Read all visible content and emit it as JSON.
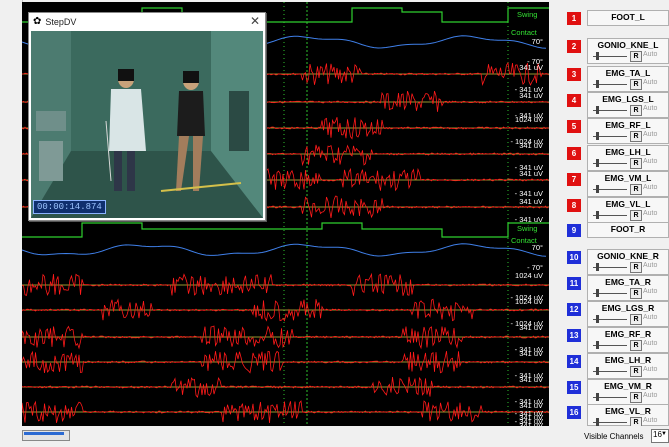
{
  "video": {
    "title": "StepDV",
    "time": "00:00:14.874"
  },
  "plot": {
    "swing_label": "Swing",
    "contact_label": "Contact",
    "labels": [
      "70°",
      "- 70°",
      "341 uV",
      "- 341 uV",
      "341 uV",
      "- 341 uV",
      "1024 uV",
      "- 1024 uV",
      "341 uV",
      "- 341 uV",
      "341 uV",
      "- 341 uV",
      "341 uV",
      "- 341 uV",
      "70°",
      "- 70°",
      "1024 uV",
      "- 1024 uV",
      "1024 uV",
      "- 1024 uV",
      "341 uV",
      "- 341 uV",
      "341 uV",
      "- 341 uV",
      "341 uV",
      "- 341 uV",
      "341 uV",
      "- 341 uV",
      "341 uV",
      "- 341 uV",
      "341 uV"
    ]
  },
  "channels": [
    {
      "num": "1",
      "name": "FOOT_L",
      "type": "foot",
      "color": "#e01010"
    },
    {
      "num": "2",
      "name": "GONIO_KNE_L",
      "type": "emg",
      "color": "#e01010"
    },
    {
      "num": "3",
      "name": "EMG_TA_L",
      "type": "emg",
      "color": "#e01010"
    },
    {
      "num": "4",
      "name": "EMG_LGS_L",
      "type": "emg",
      "color": "#e01010"
    },
    {
      "num": "5",
      "name": "EMG_RF_L",
      "type": "emg",
      "color": "#e01010"
    },
    {
      "num": "6",
      "name": "EMG_LH_L",
      "type": "emg",
      "color": "#e01010"
    },
    {
      "num": "7",
      "name": "EMG_VM_L",
      "type": "emg",
      "color": "#e01010"
    },
    {
      "num": "8",
      "name": "EMG_VL_L",
      "type": "emg",
      "color": "#e01010"
    },
    {
      "num": "9",
      "name": "FOOT_R",
      "type": "foot",
      "color": "#1f2fd8"
    },
    {
      "num": "10",
      "name": "GONIO_KNE_R",
      "type": "emg",
      "color": "#1f2fd8"
    },
    {
      "num": "11",
      "name": "EMG_TA_R",
      "type": "emg",
      "color": "#1f2fd8"
    },
    {
      "num": "12",
      "name": "EMG_LGS_R",
      "type": "emg",
      "color": "#1f2fd8"
    },
    {
      "num": "13",
      "name": "EMG_RF_R",
      "type": "emg",
      "color": "#1f2fd8"
    },
    {
      "num": "14",
      "name": "EMG_LH_R",
      "type": "emg",
      "color": "#1f2fd8"
    },
    {
      "num": "15",
      "name": "EMG_VM_R",
      "type": "emg",
      "color": "#1f2fd8"
    },
    {
      "num": "16",
      "name": "EMG_VL_R",
      "type": "emg",
      "color": "#1f2fd8"
    }
  ],
  "controls": {
    "r_label": "R",
    "auto_label": "Auto"
  },
  "footer": {
    "visible_channels_label": "Visible Channels",
    "visible_channels_value": "16"
  }
}
